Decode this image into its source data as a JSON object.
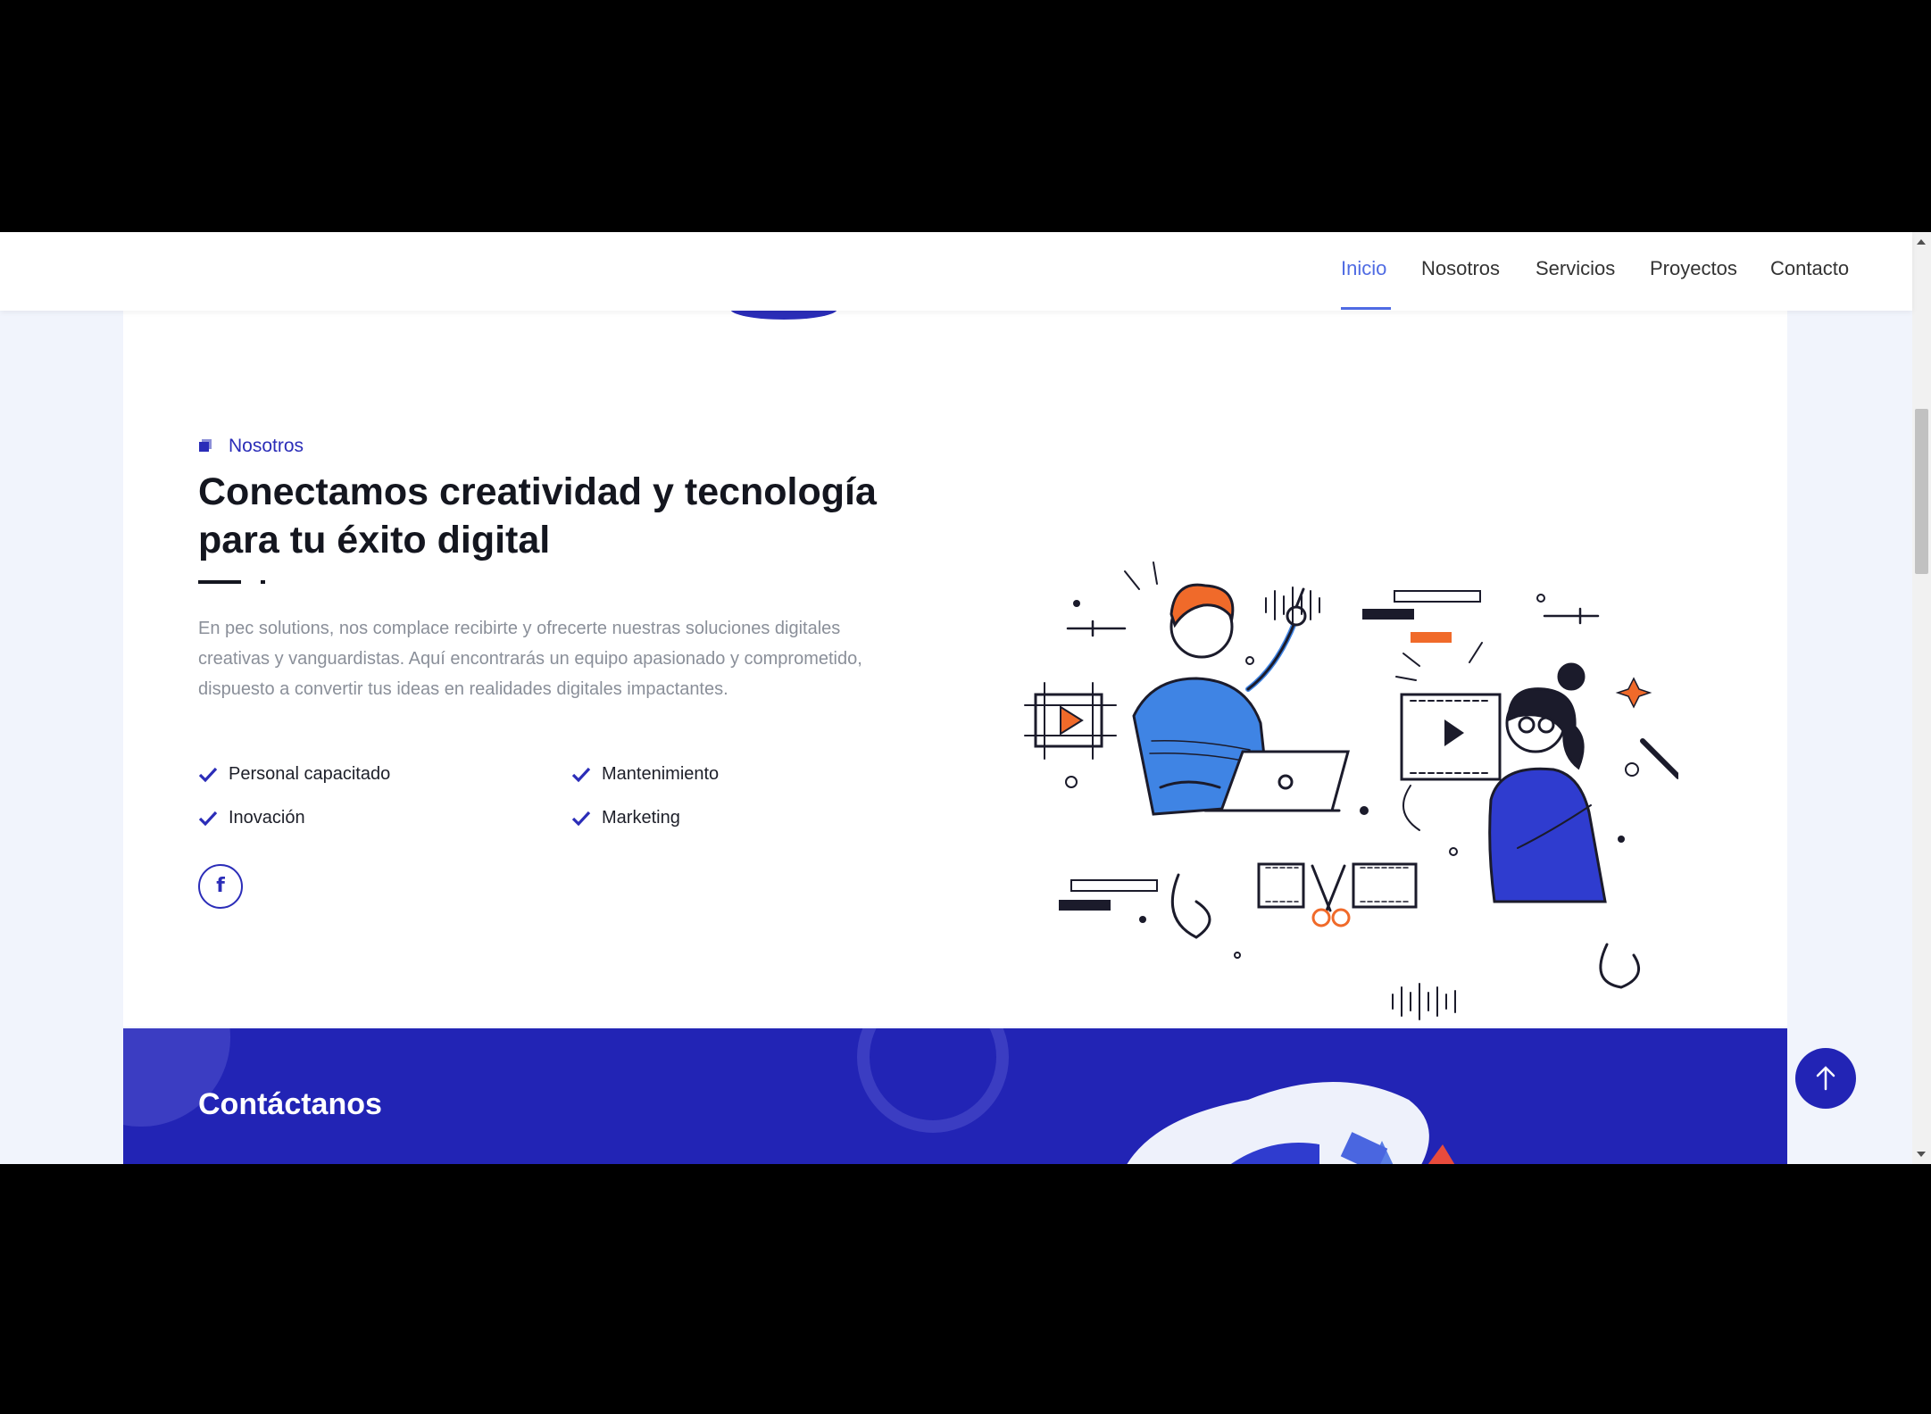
{
  "nav": {
    "items": [
      {
        "label": "Inicio",
        "active": true
      },
      {
        "label": "Nosotros",
        "active": false
      },
      {
        "label": "Servicios",
        "active": false
      },
      {
        "label": "Proyectos",
        "active": false
      },
      {
        "label": "Contacto",
        "active": false
      }
    ]
  },
  "about": {
    "eyebrow_label": "Nosotros",
    "eyebrow_icon": "layers-icon",
    "heading": "Conectamos creatividad y tecnología para tu éxito digital",
    "body": "En pec solutions, nos complace recibirte y ofrecerte nuestras soluciones digitales creativas y vanguardistas. Aquí encontrarás un equipo apasionado y comprometido, dispuesto a convertir tus ideas en realidades digitales impactantes.",
    "features": [
      "Personal capacitado",
      "Mantenimiento",
      "Inovación",
      "Marketing"
    ],
    "feature_icon": "check-icon",
    "social_icon": "facebook-icon"
  },
  "contact": {
    "title": "Contáctanos"
  },
  "back_to_top_icon": "arrow-up-icon",
  "colors": {
    "accent": "#2224b5",
    "nav_active": "#4f6be3",
    "heading": "#14161f",
    "body_text": "#8a8f99",
    "page_bg": "#f1f4fc",
    "orange": "#f06a2a"
  }
}
